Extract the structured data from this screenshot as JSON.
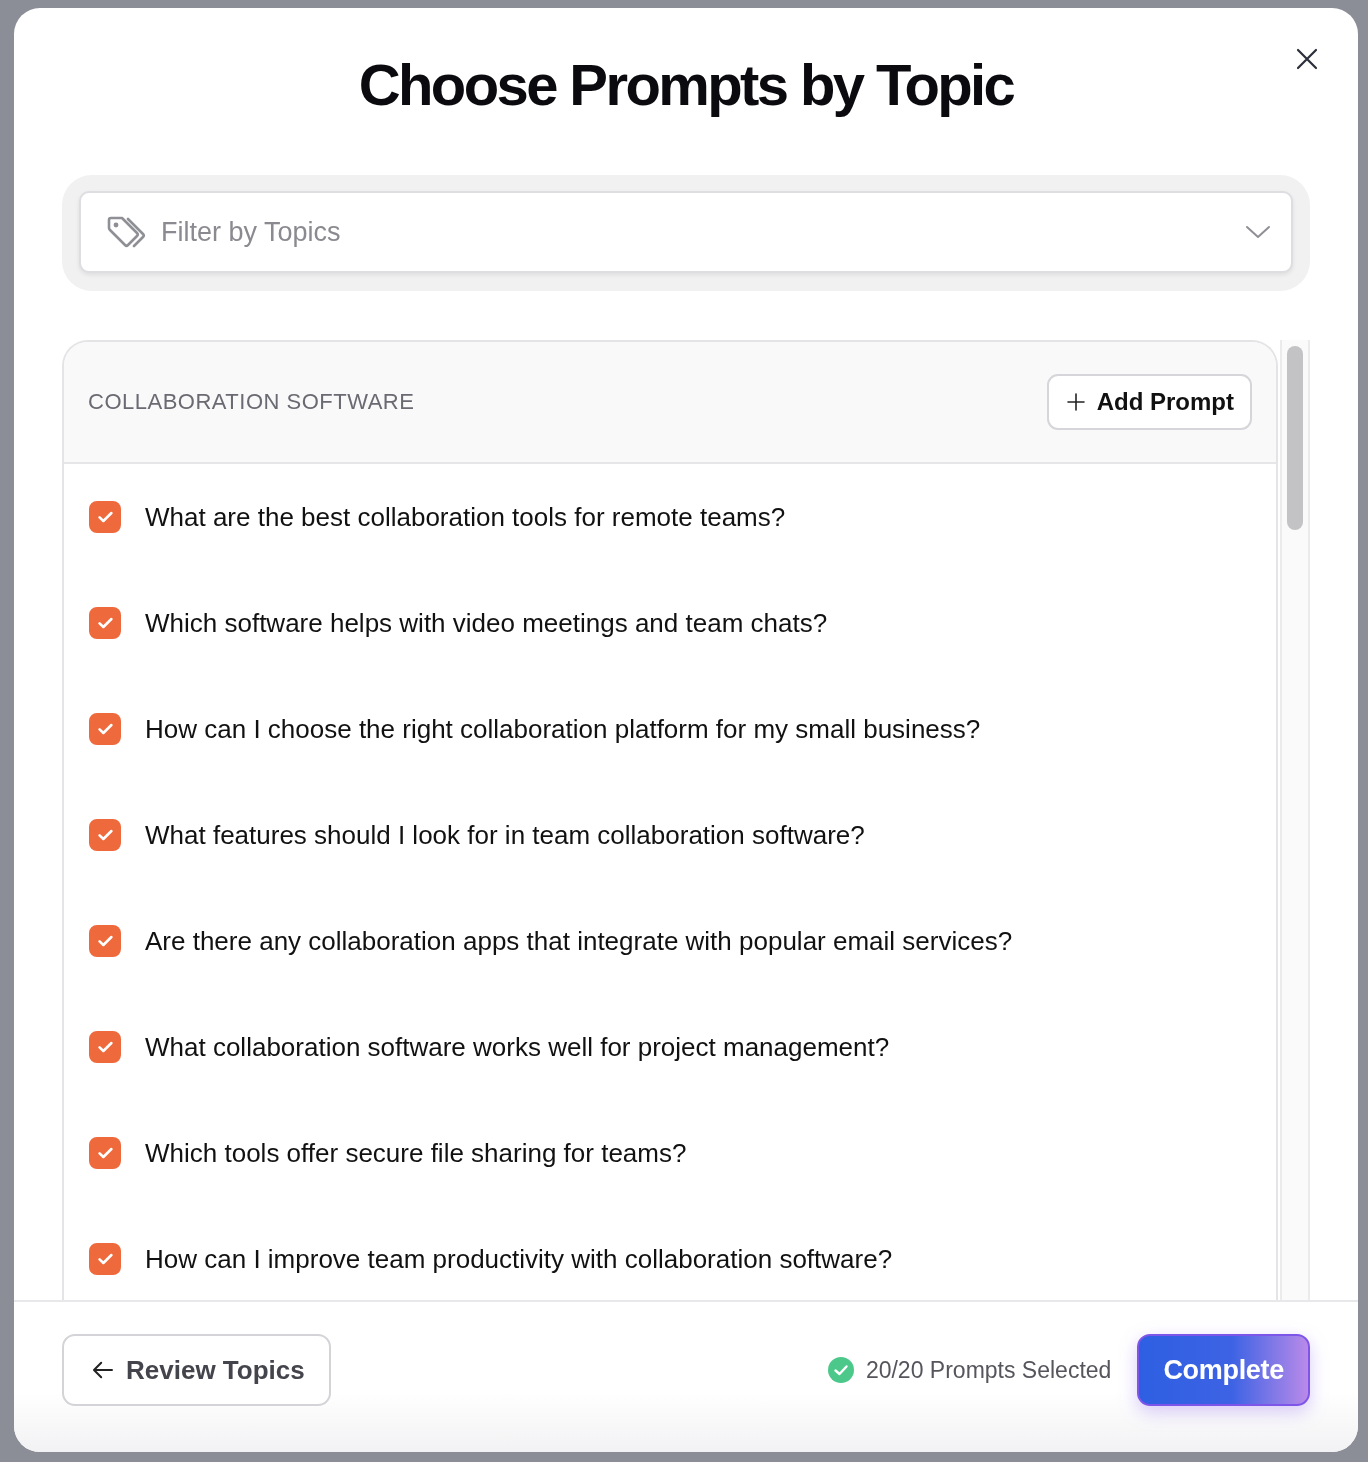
{
  "dialog": {
    "title": "Choose Prompts by Topic"
  },
  "filter": {
    "placeholder": "Filter by Topics"
  },
  "topic": {
    "name": "COLLABORATION SOFTWARE",
    "add_button": "Add Prompt",
    "prompts": [
      {
        "text": "What are the best collaboration tools for remote teams?",
        "checked": true
      },
      {
        "text": "Which software helps with video meetings and team chats?",
        "checked": true
      },
      {
        "text": "How can I choose the right collaboration platform for my small business?",
        "checked": true
      },
      {
        "text": "What features should I look for in team collaboration software?",
        "checked": true
      },
      {
        "text": "Are there any collaboration apps that integrate with popular email services?",
        "checked": true
      },
      {
        "text": "What collaboration software works well for project management?",
        "checked": true
      },
      {
        "text": "Which tools offer secure file sharing for teams?",
        "checked": true
      },
      {
        "text": "How can I improve team productivity with collaboration software?",
        "checked": true
      }
    ]
  },
  "footer": {
    "back_button": "Review Topics",
    "status": "20/20 Prompts Selected",
    "complete_button": "Complete"
  }
}
